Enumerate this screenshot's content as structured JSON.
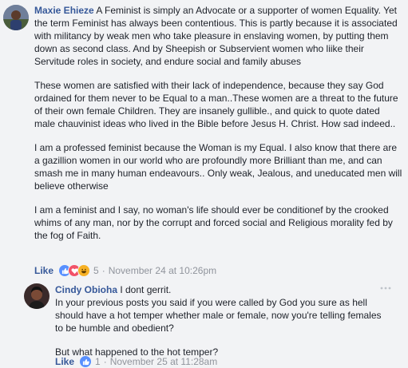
{
  "comments": [
    {
      "author": "Maxie Ehieze",
      "paragraphs": [
        "A Feminist is simply an Advocate or a supporter of women Equality. Yet the term Feminist has always been contentious. This is partly because it is associated with militancy by weak men who take pleasure in enslaving women, by putting them down as second class. And by Sheepish or Subservient women who liike their Servitude roles in society, and endure social and family abuses",
        "These women are satisfied with their lack of independence, because they say God ordained for them never to be Equal to a man..These women are a threat to the future of their own female Children. They are insanely gullible., and quick to quote dated male chauvinist ideas who lived in the Bible before Jesus H. Christ. How sad indeed..",
        "I am a professed feminist because the Woman is my Equal. I also know that there are a gazillion women in our world who are profoundly more Brilliant than me, and can smash me in many human endeavours.. Only weak, Jealous, and uneducated men will believe otherwise",
        "I am a feminist and I say, no woman's life should ever be conditionef by the crooked whims of any man, nor by the corrupt and forced social and Religious morality fed by the fog of Faith."
      ],
      "like_label": "Like",
      "separator": "·",
      "reaction_count": "5",
      "timestamp": "November 24 at 10:26pm",
      "reactions": [
        "like-icon",
        "love-icon",
        "haha-icon"
      ]
    },
    {
      "author": "Cindy Obioha",
      "paragraphs": [
        "I dont gerrit.\nIn your previous posts you said if you were called by God you sure as hell should have a hot temper whether male or female, now you're telling females to be humble and obedient?",
        "But what happened to the hot temper?"
      ],
      "like_label": "Like",
      "separator": "·",
      "reaction_count": "1",
      "timestamp": "November 25 at 11:28am",
      "reactions": [
        "like-icon"
      ],
      "more_icon": "more-options-icon"
    }
  ],
  "colors": {
    "author": "#365899",
    "text": "#1d2129",
    "meta": "#90949c",
    "like_blue": "#5890ff",
    "love_red": "#f25268",
    "haha_yellow": "#f7b125",
    "background": "#f2f3f5"
  }
}
